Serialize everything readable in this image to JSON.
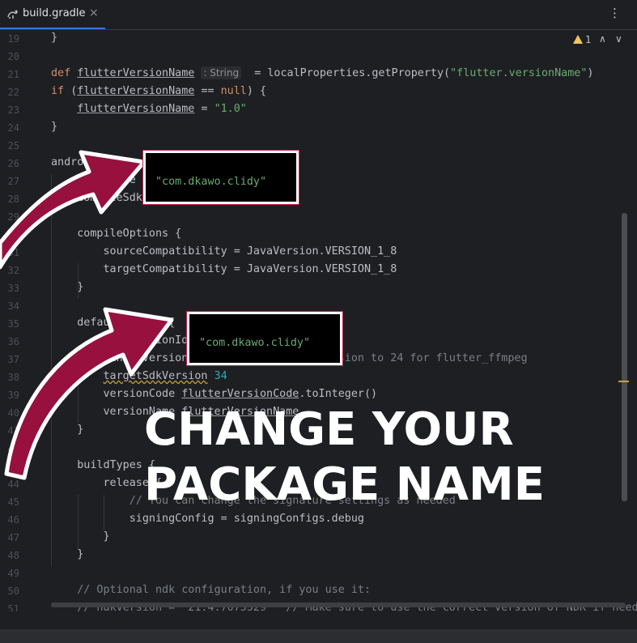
{
  "tab": {
    "label": "build.gradle",
    "close": "×"
  },
  "more_menu": "⋮",
  "inspections": {
    "count": "1",
    "up": "∧",
    "down": "∨"
  },
  "lines": [
    {
      "n": "19",
      "segs": [
        {
          "t": "}"
        }
      ]
    },
    {
      "n": "20",
      "segs": []
    },
    {
      "n": "21",
      "segs": [
        {
          "t": "def ",
          "c": "kw"
        },
        {
          "t": "flutterVersionName",
          "c": "u"
        },
        {
          "t": " "
        },
        {
          "t": ": String",
          "c": "hint"
        },
        {
          "t": "  = localProperties.getProperty("
        },
        {
          "t": "\"flutter.versionName\"",
          "c": "str"
        },
        {
          "t": ")"
        }
      ]
    },
    {
      "n": "22",
      "segs": [
        {
          "t": "if ",
          "c": "kw"
        },
        {
          "t": "("
        },
        {
          "t": "flutterVersionName",
          "c": "u"
        },
        {
          "t": " == "
        },
        {
          "t": "null",
          "c": "kw"
        },
        {
          "t": ") {"
        }
      ]
    },
    {
      "n": "23",
      "segs": [
        {
          "t": "    "
        },
        {
          "t": "flutterVersionName",
          "c": "u"
        },
        {
          "t": " = "
        },
        {
          "t": "\"1.0\"",
          "c": "str"
        }
      ]
    },
    {
      "n": "24",
      "segs": [
        {
          "t": "}"
        }
      ]
    },
    {
      "n": "25",
      "segs": []
    },
    {
      "n": "26",
      "segs": [
        {
          "t": "android {"
        }
      ]
    },
    {
      "n": "27",
      "segs": [
        {
          "t": "    namespace "
        },
        {
          "t": "\"com.dkawo.clidy\"",
          "c": "str"
        }
      ]
    },
    {
      "n": "28",
      "segs": [
        {
          "t": "    compileSdk 34"
        }
      ]
    },
    {
      "n": "29",
      "segs": []
    },
    {
      "n": "30",
      "segs": [
        {
          "t": "    compileOptions {"
        }
      ]
    },
    {
      "n": "31",
      "segs": [
        {
          "t": "        sourceCompatibility = JavaVersion.VERSION_1_8"
        }
      ]
    },
    {
      "n": "32",
      "segs": [
        {
          "t": "        targetCompatibility = JavaVersion.VERSION_1_8"
        }
      ]
    },
    {
      "n": "33",
      "segs": [
        {
          "t": "    }"
        }
      ]
    },
    {
      "n": "34",
      "segs": []
    },
    {
      "n": "35",
      "segs": [
        {
          "t": "    defaultConfig {"
        }
      ]
    },
    {
      "n": "36",
      "segs": [
        {
          "t": "        applicationId = "
        },
        {
          "t": "\"com.dkawo.clidy\"",
          "c": "str"
        }
      ]
    },
    {
      "n": "37",
      "segs": [
        {
          "t": "        minSdkVersion 24 "
        },
        {
          "t": "// Update minSdkVersion to 24 for flutter_ffmpeg",
          "c": "cmt"
        }
      ]
    },
    {
      "n": "38",
      "segs": [
        {
          "t": "        "
        },
        {
          "t": "targetSdkVersion",
          "c": "warn-u"
        },
        {
          "t": " "
        },
        {
          "t": "34",
          "c": "num"
        }
      ]
    },
    {
      "n": "39",
      "segs": [
        {
          "t": "        versionCode "
        },
        {
          "t": "flutterVersionCode",
          "c": "u"
        },
        {
          "t": ".toInteger()"
        }
      ]
    },
    {
      "n": "40",
      "segs": [
        {
          "t": "        versionName "
        },
        {
          "t": "flutterVersionName",
          "c": "u"
        }
      ]
    },
    {
      "n": "41",
      "segs": [
        {
          "t": "    }"
        }
      ]
    },
    {
      "n": "42",
      "segs": []
    },
    {
      "n": "43",
      "segs": [
        {
          "t": "    buildTypes {"
        }
      ]
    },
    {
      "n": "44",
      "segs": [
        {
          "t": "        release {"
        }
      ]
    },
    {
      "n": "45",
      "segs": [
        {
          "t": "            "
        },
        {
          "t": "// You can change the signature settings as needed",
          "c": "cmt"
        }
      ]
    },
    {
      "n": "46",
      "segs": [
        {
          "t": "            signingConfig = signingConfigs.debug"
        }
      ]
    },
    {
      "n": "47",
      "segs": [
        {
          "t": "        }"
        }
      ]
    },
    {
      "n": "48",
      "segs": [
        {
          "t": "    }"
        }
      ]
    },
    {
      "n": "49",
      "segs": []
    },
    {
      "n": "50",
      "segs": [
        {
          "t": "    "
        },
        {
          "t": "// Optional ndk configuration, if you use it:",
          "c": "cmt"
        }
      ]
    },
    {
      "n": "51",
      "segs": [
        {
          "t": "    "
        },
        {
          "t": "// ndkVersion = \"21.4.7075529\"  // Make sure to use the correct version of NDK if needed",
          "c": "cmt"
        }
      ]
    }
  ],
  "callouts": {
    "top": "\"com.dkawo.clidy\"",
    "bottom": "\"com.dkawo.clidy\""
  },
  "overlay": {
    "line1": "CHANGE YOUR",
    "line2": "PACKAGE NAME"
  },
  "colors": {
    "arrow": "#97103e",
    "arrow_outline": "#ffffff",
    "accent": "#3574f0",
    "string": "#6aab73",
    "keyword": "#cf8e6d"
  }
}
